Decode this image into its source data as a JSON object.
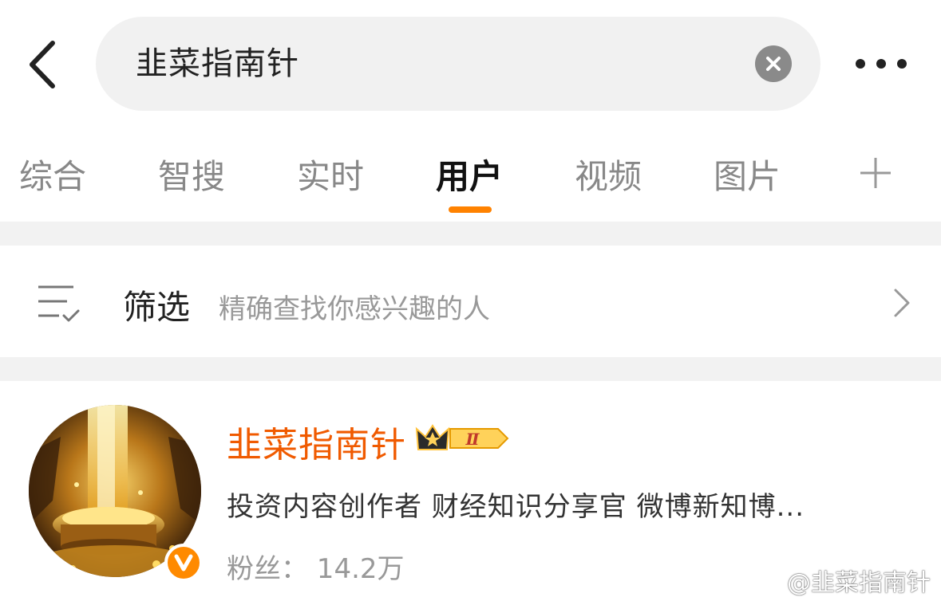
{
  "search": {
    "query": "韭菜指南针"
  },
  "tabs": [
    {
      "label": "综合"
    },
    {
      "label": "智搜"
    },
    {
      "label": "实时"
    },
    {
      "label": "用户"
    },
    {
      "label": "视频"
    },
    {
      "label": "图片"
    }
  ],
  "active_tab": "用户",
  "filter": {
    "title": "筛选",
    "subtitle": "精确查找你感兴趣的人"
  },
  "user": {
    "name": "韭菜指南针",
    "level_badge": "Ⅱ",
    "description": "投资内容创作者  财经知识分享官  微博新知博...",
    "fans": "粉丝： 14.2万",
    "verified_icon": "v-verified-icon"
  },
  "watermark": {
    "text": "@韭菜指南针"
  },
  "colors": {
    "accent": "#ff8200",
    "name": "#f05a00",
    "gray_text": "#999999",
    "divider": "#f2f2f2"
  }
}
